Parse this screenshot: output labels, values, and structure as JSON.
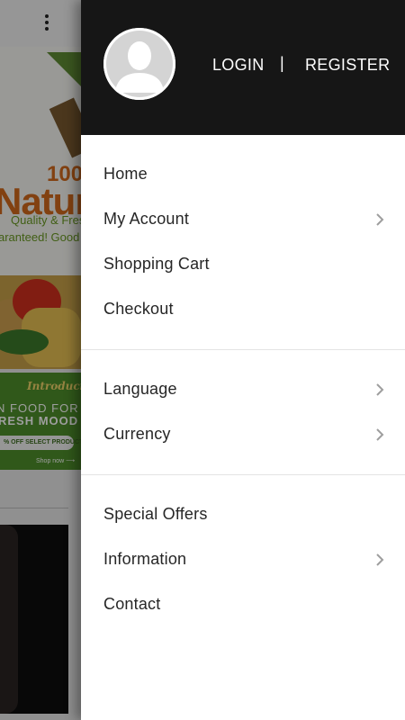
{
  "background": {
    "banner_text": {
      "percent": "100",
      "headline": "Natur",
      "line1": "Quality & Fres",
      "line2": "aranteed! Good I"
    },
    "promo": {
      "introducing": "Introducing",
      "line1": "N FOOD FOR",
      "line2": "RESH MOOD",
      "offer": "% OFF SELECT PRODUCTS",
      "shop": "Shop now ⟶"
    }
  },
  "drawer": {
    "header": {
      "login": "LOGIN",
      "separator": "|",
      "register": "REGISTER"
    },
    "group1": [
      {
        "label": "Home",
        "chevron": false
      },
      {
        "label": "My Account",
        "chevron": true
      },
      {
        "label": "Shopping Cart",
        "chevron": false
      },
      {
        "label": "Checkout",
        "chevron": false
      }
    ],
    "group2": [
      {
        "label": "Language",
        "chevron": true
      },
      {
        "label": "Currency",
        "chevron": true
      }
    ],
    "group3": [
      {
        "label": "Special Offers",
        "chevron": false
      },
      {
        "label": "Information",
        "chevron": true
      },
      {
        "label": "Contact",
        "chevron": false
      }
    ]
  },
  "colors": {
    "header_bg": "#161616",
    "drawer_bg": "#ffffff",
    "text": "#262626",
    "chevron": "#9e9e9e"
  }
}
